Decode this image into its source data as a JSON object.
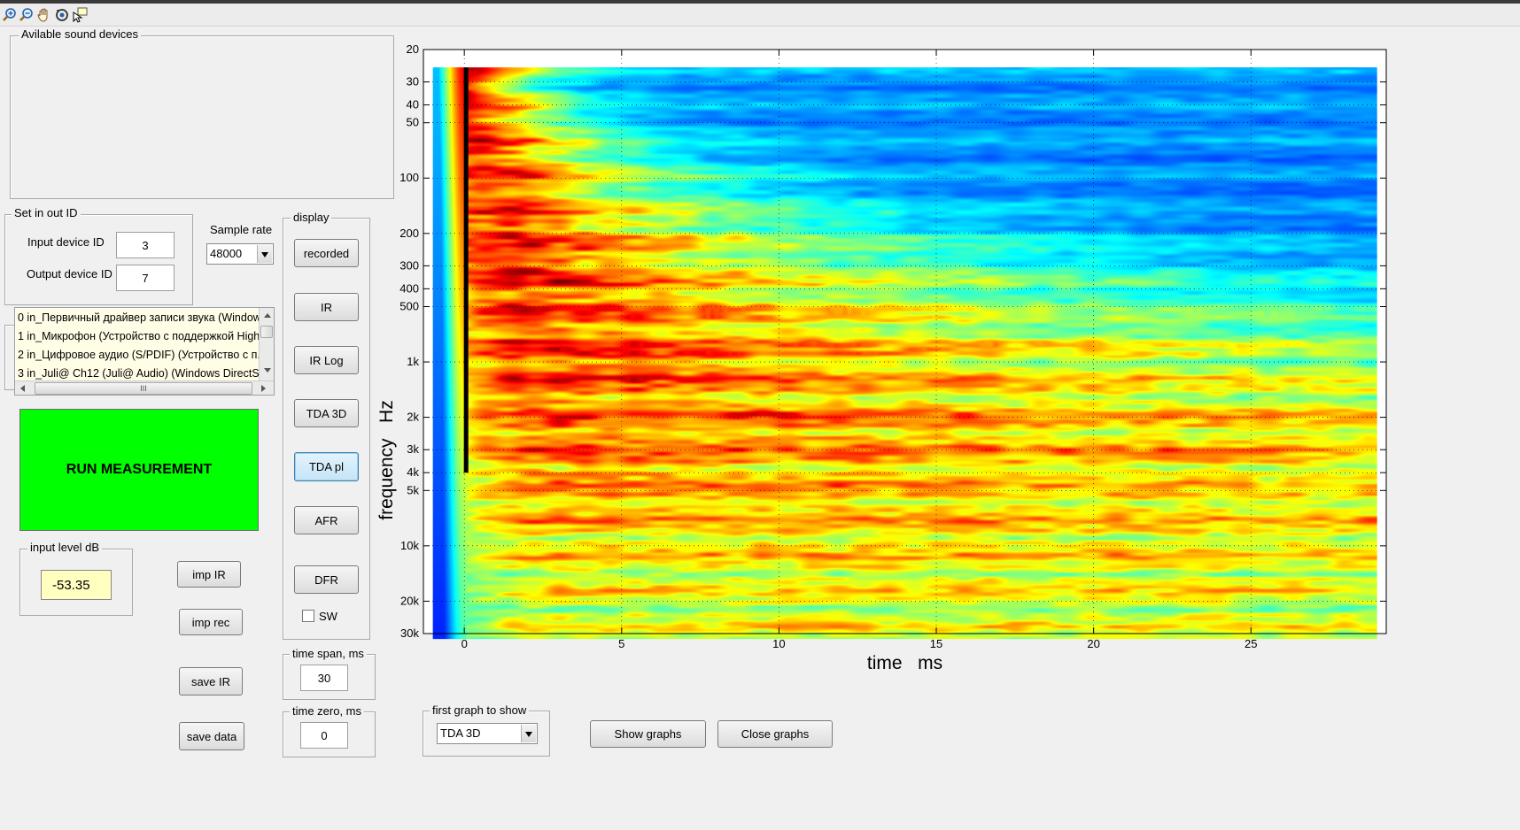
{
  "toolbar": {
    "icons": [
      "zoom-in-icon",
      "zoom-out-icon",
      "pan-hand-icon",
      "rotate-icon",
      "data-cursor-icon"
    ]
  },
  "devices": {
    "title": "Avilable sound devices"
  },
  "set_io": {
    "title": "Set in out ID",
    "input_label": "Input device ID",
    "input_value": "3",
    "output_label": "Output device ID",
    "output_value": "7"
  },
  "sample_rate": {
    "label": "Sample rate",
    "value": "48000"
  },
  "device_list": {
    "items": [
      "0 in_Первичный драйвер записи звука (Window...",
      "1 in_Микрофон (Устройство с поддержкой High...",
      "2 in_Цифровое аудио (S/PDIF) (Устройство с п...",
      "3 in_Juli@ Ch12 (Juli@ Audio) (Windows DirectS..."
    ],
    "hscroll_grip": "III"
  },
  "run_button": {
    "label": "RUN MEASUREMENT"
  },
  "input_level": {
    "title": "input level dB",
    "value": "-53.35"
  },
  "left_buttons": {
    "imp_ir": "imp IR",
    "imp_rec": "imp rec",
    "save_ir": "save IR",
    "save_data": "save data"
  },
  "display": {
    "title": "display",
    "buttons": [
      "recorded",
      "IR",
      "IR Log",
      "TDA 3D",
      "TDA pl",
      "AFR",
      "DFR"
    ],
    "active": "TDA pl",
    "sw_label": "SW",
    "sw_checked": false
  },
  "time_span": {
    "title": "time span, ms",
    "value": "30"
  },
  "time_zero": {
    "title": "time zero, ms",
    "value": "0"
  },
  "first_graph": {
    "title": "first graph to show",
    "value": "TDA 3D"
  },
  "actions": {
    "show": "Show graphs",
    "close": "Close graphs"
  },
  "chart_data": {
    "type": "heatmap",
    "xlabel": "time   ms",
    "ylabel": "frequency   Hz",
    "x_ticks": [
      "0",
      "5",
      "10",
      "15",
      "20",
      "25"
    ],
    "x_tick_values": [
      0,
      5,
      10,
      15,
      20,
      25
    ],
    "xlim": [
      -1.3,
      29.3
    ],
    "y_ticks": [
      "20",
      "30",
      "40",
      "50",
      "100",
      "200",
      "300",
      "400",
      "500",
      "1k",
      "2k",
      "3k",
      "4k",
      "5k",
      "10k",
      "20k",
      "30k"
    ],
    "y_tick_values": [
      20,
      30,
      40,
      50,
      100,
      200,
      300,
      400,
      500,
      1000,
      2000,
      3000,
      4000,
      5000,
      10000,
      20000,
      30000
    ],
    "yscale": "log",
    "ylim": [
      20,
      30000
    ],
    "y_direction": "reversed",
    "data_extent": {
      "time_ms": [
        -1,
        29
      ],
      "freq_hz": [
        25,
        32000
      ]
    },
    "colormap": "jet",
    "colors": {
      "low": "#00008f",
      "mid": "#00ffff",
      "high": "#ff0000",
      "peak": "#000000"
    }
  }
}
